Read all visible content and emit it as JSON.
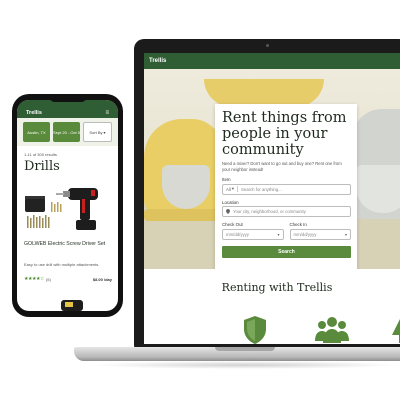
{
  "laptop": {
    "brand": "Trellis",
    "hero_card": {
      "title": "Rent things from people in your community",
      "subtitle": "Need a mixer? Don't want to go out and buy one? Rent one from your neighbor instead!",
      "item_label": "Item",
      "item_prefix": "All",
      "item_placeholder": "Search for anything...",
      "location_label": "Location",
      "location_placeholder": "Your city, neighborhood, or community",
      "checkout_label": "Check Out",
      "checkout_placeholder": "mm/dd/yyyy",
      "checkin_label": "Check In",
      "checkin_placeholder": "mm/dd/yyyy",
      "search_button": "Search"
    },
    "section_title": "Renting with Trellis",
    "icons": [
      "shield-icon",
      "community-icon",
      "tree-icon"
    ],
    "accent": "#5a8a3c",
    "nav_color": "#2f5d34"
  },
  "phone": {
    "brand": "Trellis",
    "filters": [
      "Austin, TX",
      "Sept 20 - Oct 5",
      "Sort By"
    ],
    "result_count": "1-11 of 300 results",
    "category_title": "Drills",
    "product": {
      "name": "GOLWEB Electric Screw Driver Set",
      "description": "Easy to use drill with multiple attachments.",
      "rating": 4,
      "rating_count": "(5)",
      "price": "$8.00 /day"
    }
  }
}
